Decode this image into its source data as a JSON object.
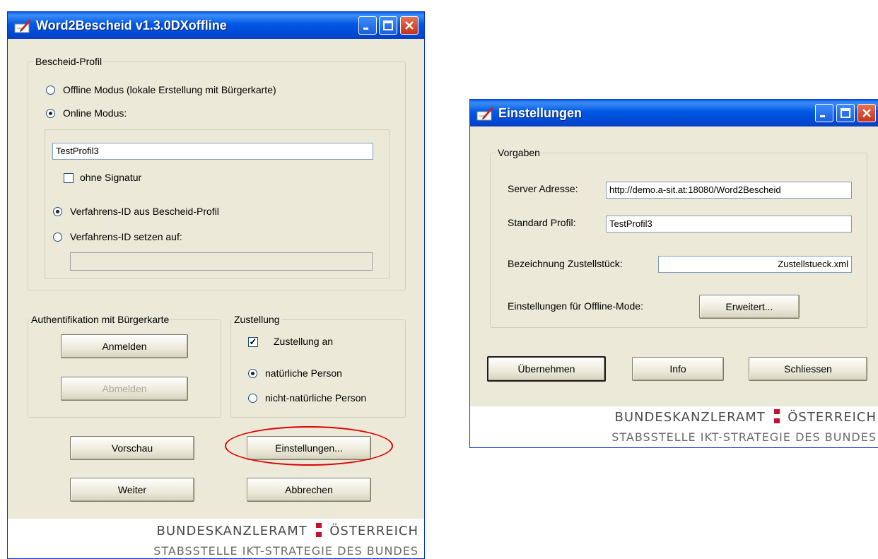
{
  "colors": {
    "title_bar": "#0058e6",
    "dialog_bg": "#ece9d8",
    "highlight": "#e00000",
    "flag_red": "#c8102e"
  },
  "main_window": {
    "title": "Word2Bescheid v1.3.0DXoffline",
    "icon": "pen-document-icon",
    "profile_group": {
      "legend": "Bescheid-Profil",
      "offline_mode_label": "Offline Modus (lokale Erstellung mit Bürgerkarte)",
      "offline_mode_selected": false,
      "online_mode_label": "Online Modus:",
      "online_mode_selected": true,
      "profile_value": "TestProfil3",
      "no_signature_label": "ohne Signatur",
      "no_signature_checked": false,
      "verfahren_from_profile_label": "Verfahrens-ID aus Bescheid-Profil",
      "verfahren_from_profile_selected": true,
      "verfahren_set_label": "Verfahrens-ID setzen auf:",
      "verfahren_set_selected": false,
      "verfahren_value": ""
    },
    "auth_group": {
      "legend": "Authentifikation mit Bürgerkarte",
      "login_button": "Anmelden",
      "logout_button": "Abmelden"
    },
    "delivery_group": {
      "legend": "Zustellung",
      "delivery_on_label": "Zustellung an",
      "delivery_on_checked": true,
      "natural_person_label": "natürliche Person",
      "natural_person_selected": true,
      "legal_person_label": "nicht-natürliche Person",
      "legal_person_selected": false
    },
    "buttons": {
      "preview": "Vorschau",
      "settings": "Einstellungen...",
      "next": "Weiter",
      "cancel": "Abbrechen"
    },
    "footer": {
      "line1_left": "BUNDESKANZLERAMT",
      "line1_right": "ÖSTERREICH",
      "line2": "STABSSTELLE IKT-STRATEGIE DES BUNDES"
    }
  },
  "settings_window": {
    "title": "Einstellungen",
    "icon": "pen-document-icon",
    "group": {
      "legend": "Vorgaben",
      "server_label": "Server Adresse:",
      "server_value": "http://demo.a-sit.at:18080/Word2Bescheid",
      "profile_label": "Standard Profil:",
      "profile_value": "TestProfil3",
      "delivery_label": "Bezeichnung Zustellstück:",
      "delivery_value": "Zustellstueck.xml",
      "offline_label": "Einstellungen für Offline-Mode:",
      "advanced_button": "Erweitert..."
    },
    "buttons": {
      "apply": "Übernehmen",
      "info": "Info",
      "close": "Schliessen"
    },
    "footer": {
      "line1_left": "BUNDESKANZLERAMT",
      "line1_right": "ÖSTERREICH",
      "line2": "STABSSTELLE IKT-STRATEGIE DES BUNDES"
    }
  }
}
